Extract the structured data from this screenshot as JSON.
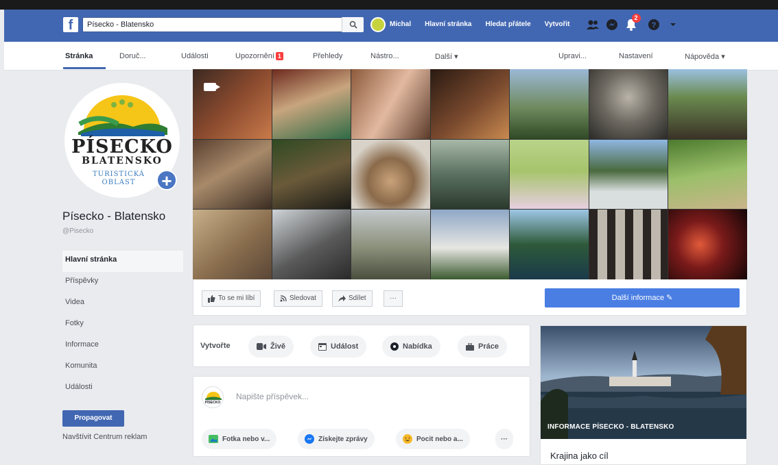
{
  "topbar": {
    "logo": "f",
    "search_value": "Písecko - Blatensko",
    "user_name": "Michal",
    "links": [
      "Hlavní stránka",
      "Hledat přátele",
      "Vytvořit"
    ],
    "notification_count": "2"
  },
  "tabs": {
    "items": [
      "Stránka",
      "Doruč...",
      "Události",
      "Upozornění",
      "Přehledy",
      "Nástro...",
      "Další ▾"
    ],
    "notification_badge": "1",
    "right_items": [
      "Upravi...",
      "Nastavení",
      "Nápověda ▾"
    ]
  },
  "profile": {
    "logo_line1": "PÍSECKO",
    "logo_line2": "BLATENSKO",
    "logo_line3": "TURISTICKÁ",
    "logo_line4": "OBLAST",
    "add_symbol": "+",
    "name": "Písecko - Blatensko",
    "handle": "@Pisecko"
  },
  "sidebar": {
    "items": [
      "Hlavní stránka",
      "Příspěvky",
      "Videa",
      "Fotky",
      "Informace",
      "Komunita",
      "Události"
    ],
    "promote_label": "Propagovat",
    "ad_center": "Navštívit Centrum reklam"
  },
  "actions": {
    "like": "To se mi líbí",
    "follow": "Sledovat",
    "share": "Sdílet",
    "more": "···",
    "more_info": "Další informace ✎"
  },
  "create": {
    "label": "Vytvořte",
    "live": "Živě",
    "event": "Událost",
    "offer": "Nabídka",
    "job": "Práce"
  },
  "composer": {
    "placeholder": "Napište příspěvek...",
    "mini_logo_text": "PÍSECKO",
    "photo": "Fotka nebo v...",
    "messages": "Získejte zprávy",
    "feeling": "Pocit nebo a...",
    "more": "···"
  },
  "infocard": {
    "caption": "INFORMACE PÍSECKO - BLATENSKO",
    "subtitle": "Krajina jako cíl"
  },
  "colors": {
    "brand_blue": "#4267b2",
    "button_blue": "#4a7ee3",
    "badge_red": "#fa3e3e",
    "page_bg": "#e9ebee"
  }
}
